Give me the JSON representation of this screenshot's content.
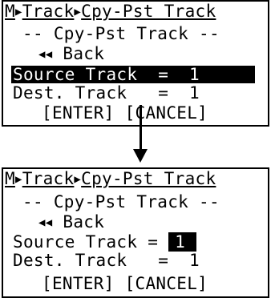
{
  "screen_before": {
    "breadcrumb": {
      "menu": "M",
      "level1": "Track",
      "level2": "Cpy-Pst Track"
    },
    "title": "-- Cpy-Pst Track --",
    "back_label": "Back",
    "source_label": "Source Track",
    "source_value": "1",
    "dest_label": "Dest. Track",
    "dest_value": "1",
    "enter_label": "[ENTER]",
    "cancel_label": "[CANCEL]"
  },
  "screen_after": {
    "breadcrumb": {
      "menu": "M",
      "level1": "Track",
      "level2": "Cpy-Pst Track"
    },
    "title": "-- Cpy-Pst Track --",
    "back_label": "Back",
    "source_label": "Source Track",
    "source_value": "1",
    "dest_label": "Dest. Track",
    "dest_value": "1",
    "enter_label": "[ENTER]",
    "cancel_label": "[CANCEL]"
  },
  "icons": {
    "breadcrumb_separator": "right-triangle-icon",
    "back": "double-left-triangle-icon",
    "connector": "down-arrow-icon"
  },
  "colors": {
    "foreground": "#000000",
    "background": "#ffffff",
    "highlight": "#000000"
  }
}
